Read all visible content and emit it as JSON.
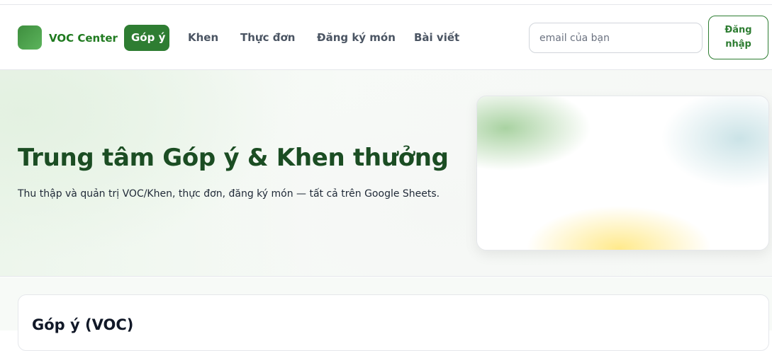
{
  "brand": {
    "name": "VOC Center"
  },
  "nav": {
    "items": [
      {
        "label": "Góp ý",
        "active": true
      },
      {
        "label": "Khen",
        "active": false
      },
      {
        "label": "Thực đơn",
        "active": false
      },
      {
        "label": "Đăng ký món",
        "active": false
      },
      {
        "label": "Bài viết",
        "active": false
      }
    ]
  },
  "auth": {
    "email_placeholder": "email của bạn",
    "email_value": "",
    "login_label": "Đăng nhập"
  },
  "hero": {
    "title": "Trung tâm Góp ý & Khen thưởng",
    "subtitle": "Thu thập và quản trị VOC/Khen, thực đơn, đăng ký món — tất cả trên Google Sheets."
  },
  "section": {
    "title": "Góp ý (VOC)"
  },
  "colors": {
    "accent": "#2e7d32",
    "title": "#1b4d23"
  }
}
